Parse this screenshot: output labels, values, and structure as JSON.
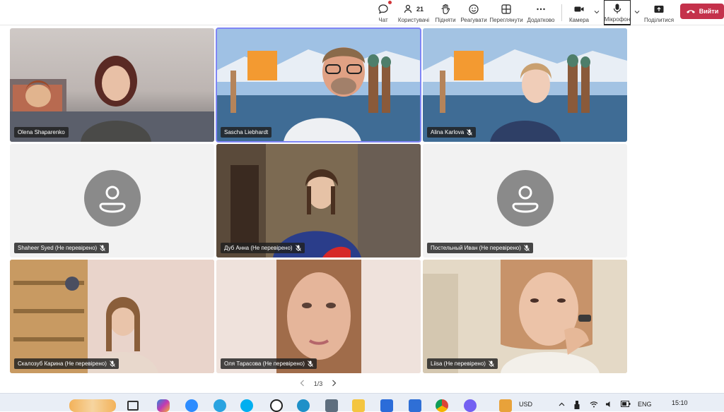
{
  "toolbar": {
    "chat_label": "Чат",
    "people_label": "Користувачі",
    "people_count": "21",
    "raise_label": "Підняти",
    "react_label": "Реагувати",
    "view_label": "Переглянути",
    "more_label": "Додатково",
    "camera_label": "Камера",
    "mic_label": "Мікрофон",
    "share_label": "Поділитися",
    "leave_label": "Вийти"
  },
  "participants": [
    {
      "name": "Olena Shaparenko"
    },
    {
      "name": "Sascha Liebhardt"
    },
    {
      "name": "Alina Karlova"
    },
    {
      "name": "Shaheer Syed (Не перевірено)"
    },
    {
      "name": "Дуб Анна (Не перевірено)"
    },
    {
      "name": "Постельный Иван (Не перевірено)"
    },
    {
      "name": "Скалозуб Карина (Не перевірено)"
    },
    {
      "name": "Оля Тарасова (Не перевірено)"
    },
    {
      "name": "Liisa (Не перевірено)"
    }
  ],
  "pager": {
    "text": "1/3"
  },
  "taskbar": {
    "currency": "USD",
    "language": "ENG",
    "time": "15:10"
  },
  "colors": {
    "leave": "#c4314b",
    "active_outline": "#7f85f5",
    "avatar": "#8a8a8a"
  }
}
